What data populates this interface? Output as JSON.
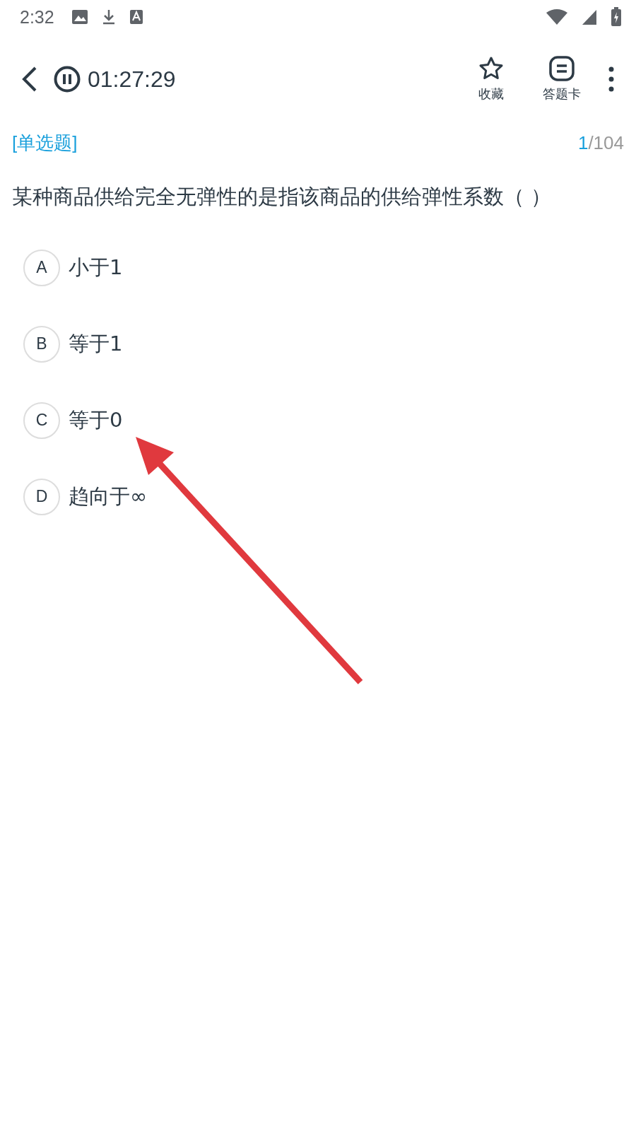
{
  "status_bar": {
    "time": "2:32"
  },
  "header": {
    "timer": "01:27:29",
    "actions": [
      {
        "kind": "star",
        "label": "收藏"
      },
      {
        "kind": "card",
        "label": "答题卡"
      }
    ]
  },
  "question": {
    "type": "[单选题]",
    "current": "1",
    "total": "/104",
    "text": "某种商品供给完全无弹性的是指该商品的供给弹性系数（ ）",
    "options": [
      {
        "letter": "A",
        "text": "小于1"
      },
      {
        "letter": "B",
        "text": "等于1"
      },
      {
        "letter": "C",
        "text": "等于0"
      },
      {
        "letter": "D",
        "text": "趋向于∞"
      }
    ]
  }
}
